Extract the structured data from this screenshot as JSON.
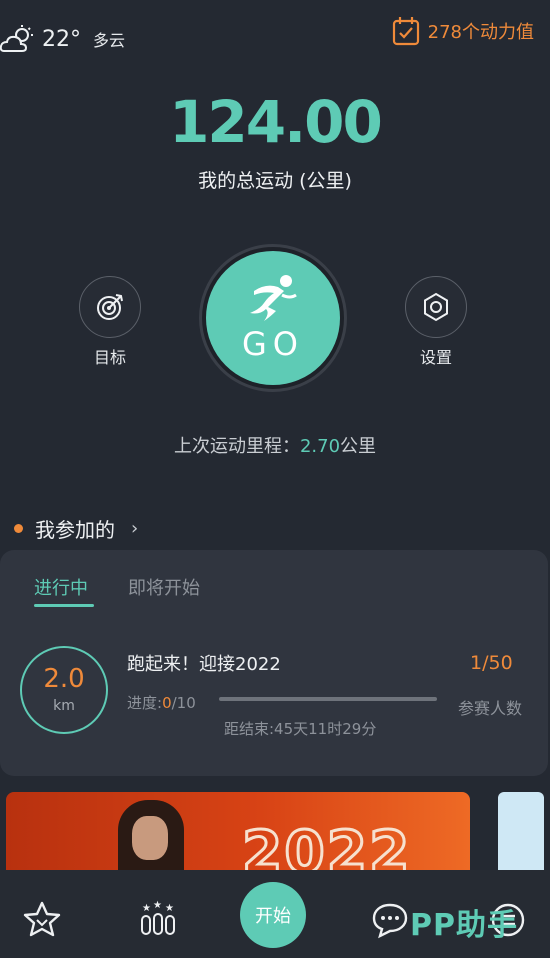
{
  "weather": {
    "icon": "partly-cloudy-icon",
    "temperature": "22°",
    "condition": "多云"
  },
  "energy": {
    "icon": "calendar-check-icon",
    "text": "278个动力值",
    "color": "#ef8a3a"
  },
  "summary": {
    "total_distance": "124.00",
    "total_label": "我的总运动 (公里)"
  },
  "actions": {
    "goal_label": "目标",
    "goal_icon": "target-icon",
    "go_label": "GO",
    "go_icon": "runner-icon",
    "settings_label": "设置",
    "settings_icon": "gear-icon"
  },
  "last_run": {
    "prefix": "上次运动里程：",
    "value": "2.70",
    "unit": "公里"
  },
  "joined": {
    "title": "我参加的",
    "chevron": "›"
  },
  "event_card": {
    "tabs": [
      {
        "label": "进行中",
        "active": true
      },
      {
        "label": "即将开始",
        "active": false
      }
    ],
    "distance_value": "2.0",
    "distance_unit": "km",
    "title": "跑起来！迎接2022",
    "progress_prefix": "进度:",
    "progress_current": "0",
    "progress_total": "/10",
    "progress_fraction": 0,
    "countdown": "距结束:45天11时29分",
    "participants": "1/50",
    "participants_label": "参赛人数"
  },
  "banner": {
    "year_text": "2022"
  },
  "bottom_nav": {
    "items": [
      {
        "icon": "star-medal-icon"
      },
      {
        "icon": "ranking-icon"
      },
      {
        "label": "开始"
      },
      {
        "icon": "chat-icon"
      },
      {
        "icon": "more-icon"
      }
    ],
    "watermark": "PP助手"
  },
  "colors": {
    "accent": "#5ecbb5",
    "highlight": "#ef8a3a",
    "background": "#242932"
  }
}
